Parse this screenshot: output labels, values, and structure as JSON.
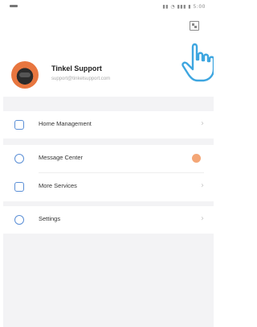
{
  "status_bar": {
    "right_text": "▮▮ ◔ ▮▮▮ ▮ 5:00"
  },
  "header": {
    "scan_icon": "qr-code-icon",
    "pointer_icon": "pointing-hand-icon"
  },
  "profile": {
    "name": "Tinkel Support",
    "subtitle": "support@tinkelsupport.com"
  },
  "menu": {
    "home_management": "Home Management",
    "message_center": "Message Center",
    "more_services": "More Services",
    "settings": "Settings"
  },
  "colors": {
    "accent": "#5b8fd6",
    "badge": "#f4a676",
    "avatar": "#e8763f"
  }
}
